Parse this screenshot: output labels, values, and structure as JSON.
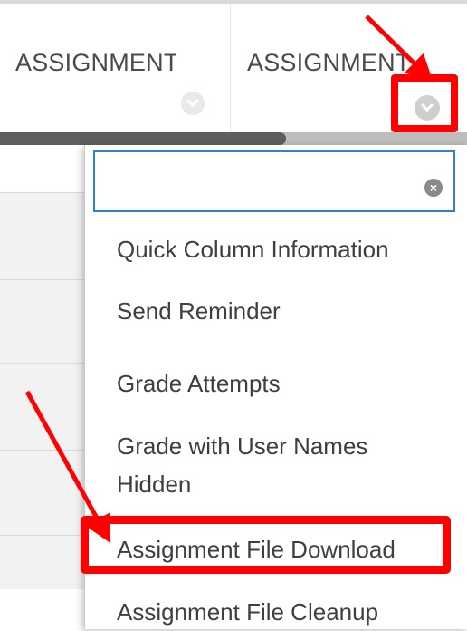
{
  "columns": [
    {
      "title": "ASSIGNMENT"
    },
    {
      "title": "ASSIGNMENT"
    }
  ],
  "search": {
    "placeholder": "",
    "value": ""
  },
  "menu": {
    "items": [
      {
        "label": "Quick Column Information"
      },
      {
        "label": "Send Reminder"
      },
      {
        "label": "Grade Attempts"
      },
      {
        "label": "Grade with User Names Hidden"
      },
      {
        "label": "Assignment File Download"
      },
      {
        "label": "Assignment File Cleanup"
      }
    ]
  },
  "colors": {
    "annotation": "#ff0000",
    "focus_border": "#2a82d0"
  },
  "icons": {
    "column_menu": "chevron-down-icon",
    "clear_search": "clear-icon"
  }
}
